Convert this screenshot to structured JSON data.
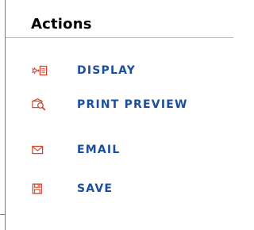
{
  "panel": {
    "title": "Actions"
  },
  "actions": [
    {
      "label": "DISPLAY",
      "icon": "display-icon"
    },
    {
      "label": "PRINT PREVIEW",
      "icon": "print-preview-icon"
    },
    {
      "label": "EMAIL",
      "icon": "email-icon"
    },
    {
      "label": "SAVE",
      "icon": "save-icon"
    }
  ],
  "colors": {
    "link": "#1a4f9e",
    "icon": "#d9412b"
  }
}
